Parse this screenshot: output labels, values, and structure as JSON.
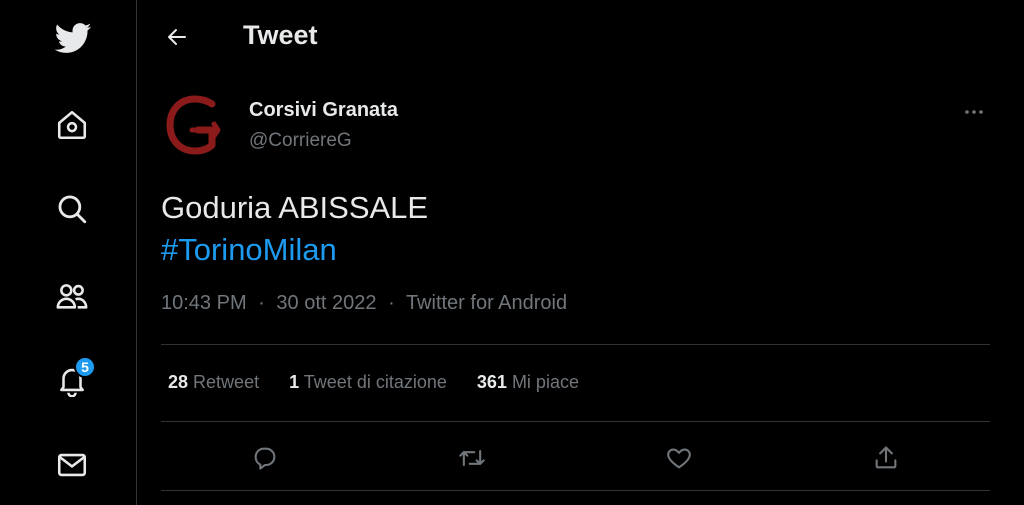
{
  "sidebar": {
    "items": [
      {
        "name": "twitter-logo",
        "label": "Twitter"
      },
      {
        "name": "home",
        "label": "Home"
      },
      {
        "name": "explore",
        "label": "Explore"
      },
      {
        "name": "communities",
        "label": "Communities"
      },
      {
        "name": "notifications",
        "label": "Notifications",
        "badge": "5"
      },
      {
        "name": "messages",
        "label": "Messages"
      }
    ],
    "notifications_badge": "5"
  },
  "header": {
    "title": "Tweet"
  },
  "tweet": {
    "author_name": "Corsivi Granata",
    "author_handle": "@CorriereG",
    "text_line1": "Goduria ABISSALE",
    "hashtag": "#TorinoMilan",
    "time": "10:43 PM",
    "separator": "·",
    "date": "30 ott 2022",
    "source": "Twitter for Android"
  },
  "stats": {
    "retweets_count": "28",
    "retweets_label": "Retweet",
    "quotes_count": "1",
    "quotes_label": "Tweet di citazione",
    "likes_count": "361",
    "likes_label": "Mi piace"
  },
  "colors": {
    "accent": "#1d9bf0",
    "background": "#000000",
    "text_primary": "#e7e9ea",
    "text_secondary": "#71767b",
    "border": "#2f3336",
    "avatar_brand": "#8b1a1a"
  },
  "icons": {
    "back": "arrow-left-icon",
    "more": "more-horizontal-icon",
    "reply": "reply-icon",
    "retweet": "retweet-icon",
    "like": "heart-icon",
    "share": "share-icon"
  }
}
